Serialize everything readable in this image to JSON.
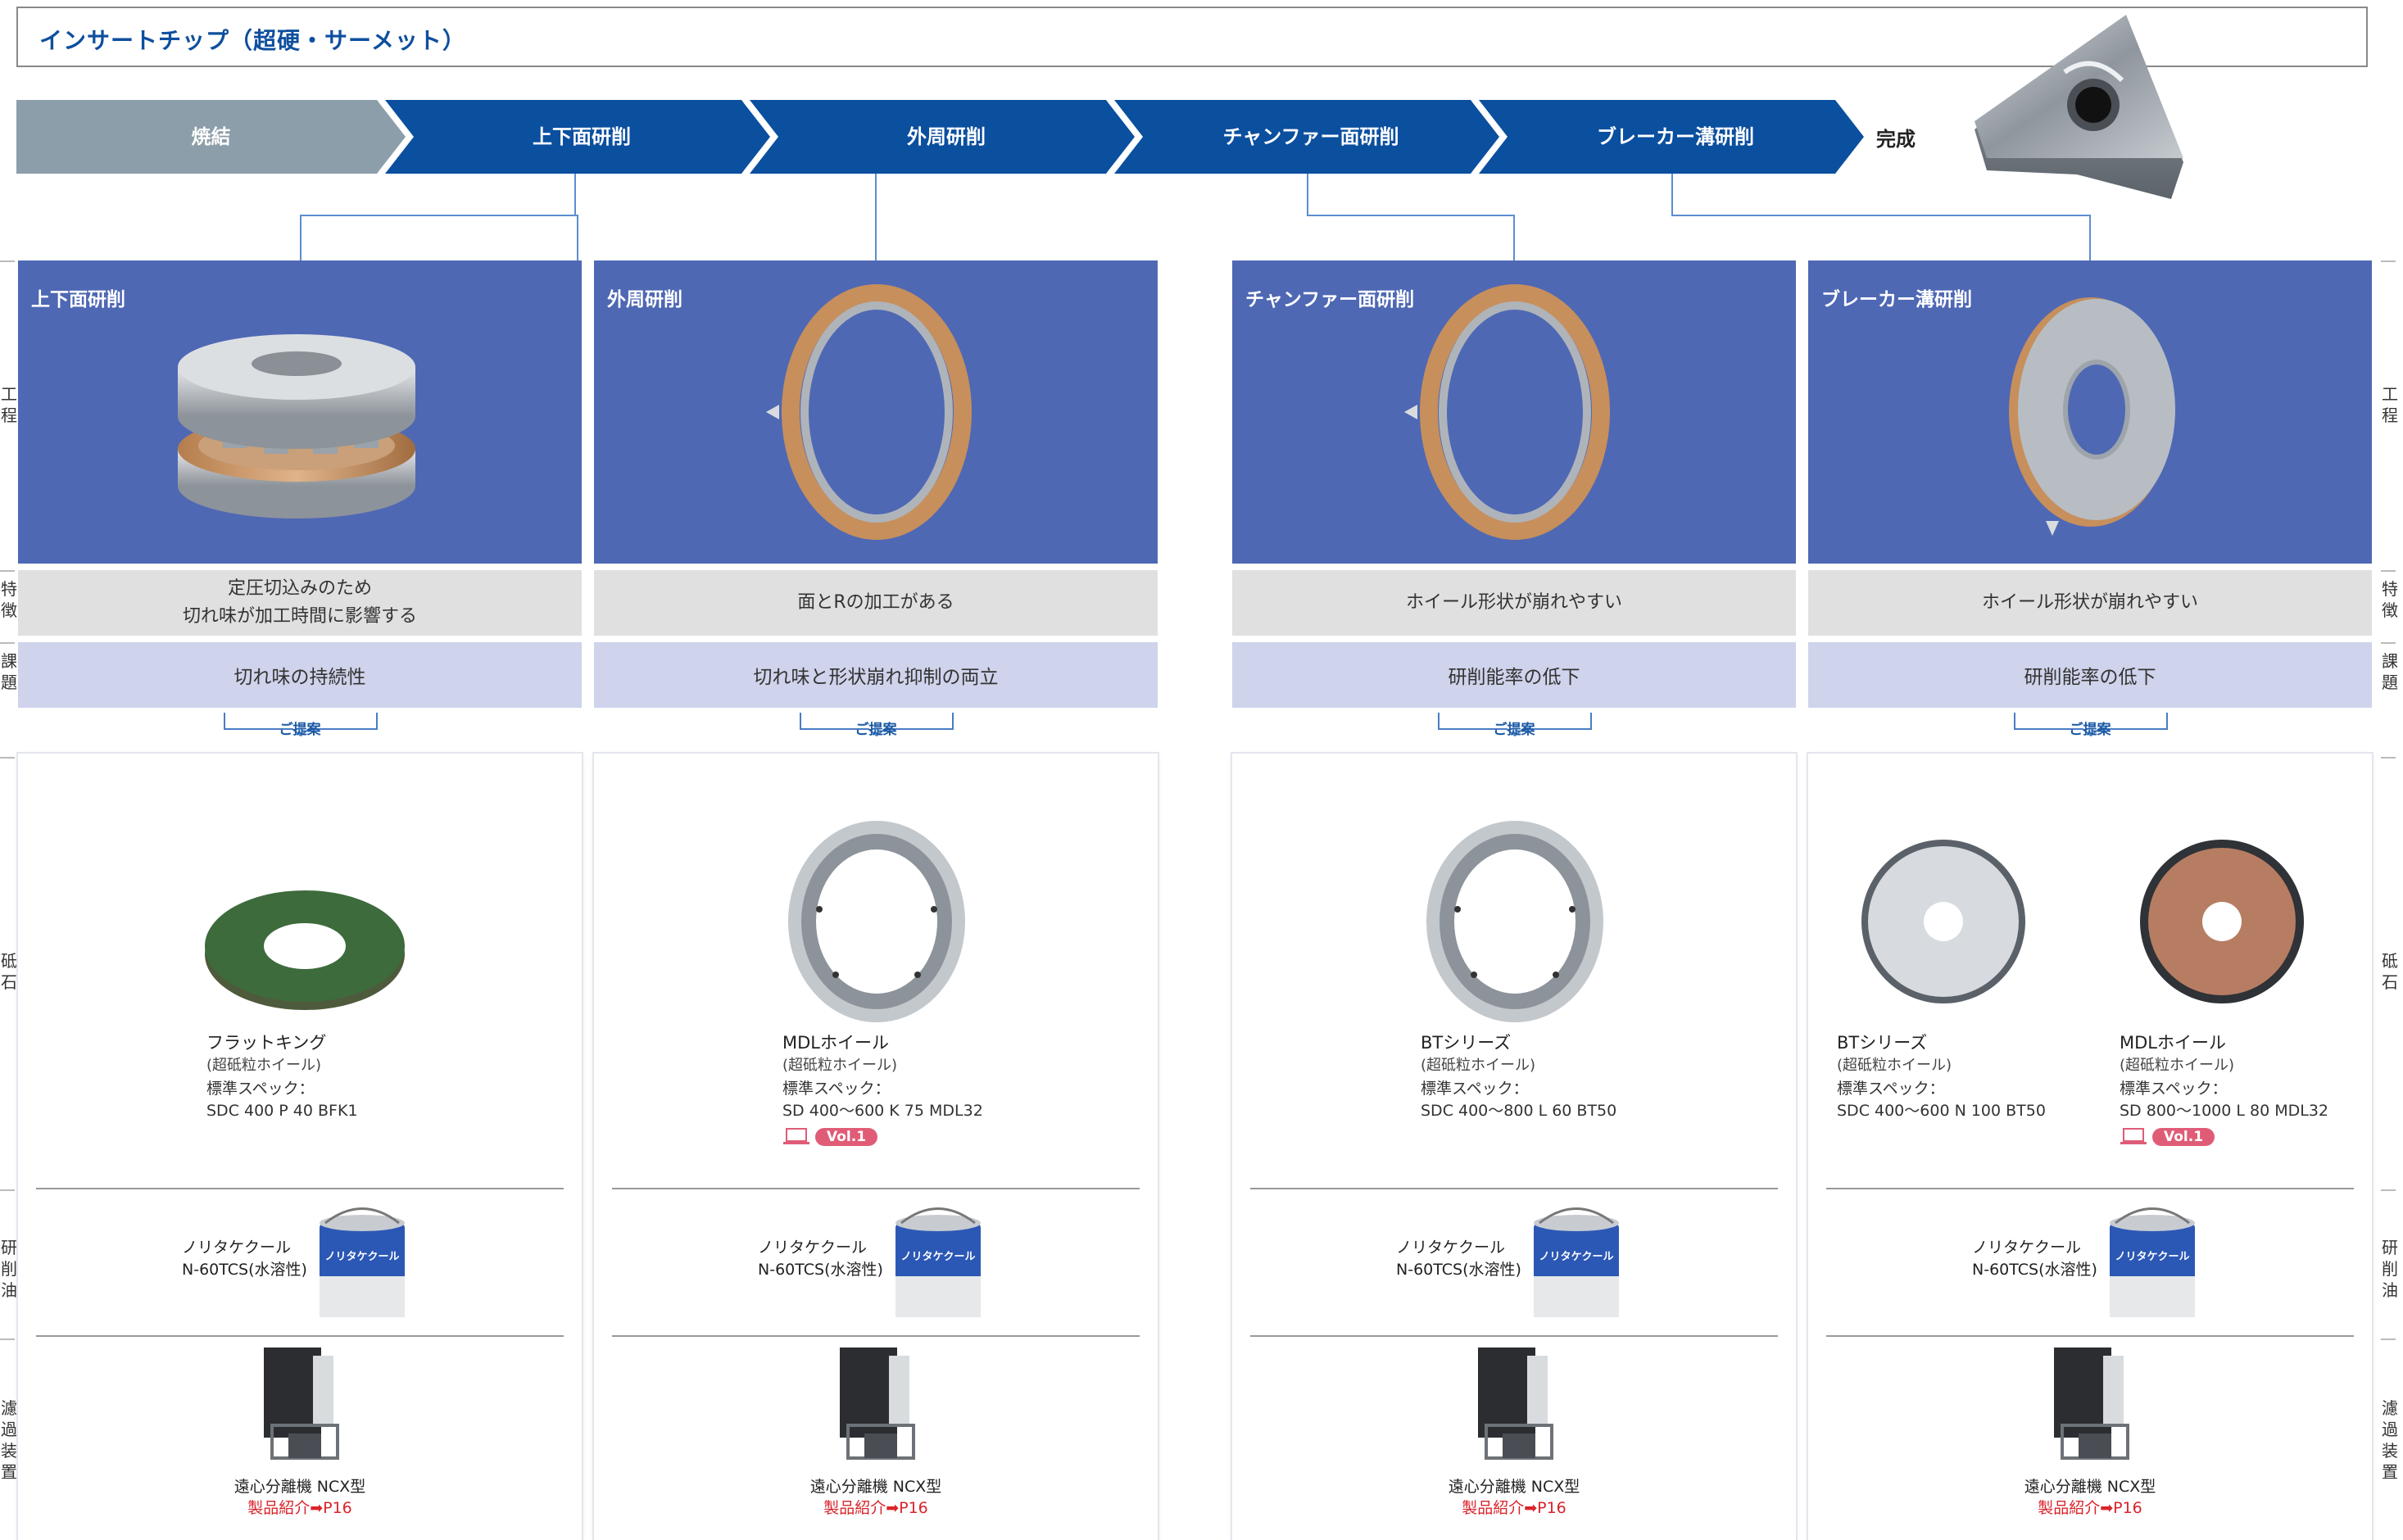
{
  "title": "インサートチップ（超硬・サーメット）",
  "flow": {
    "steps": [
      "焼結",
      "上下面研削",
      "外周研削",
      "チャンファー面研削",
      "ブレーカー溝研削"
    ],
    "final": "完成",
    "colors": {
      "first": "#8c9ea9",
      "rest": "#0b4f9f"
    }
  },
  "side_labels": {
    "process": "工程",
    "feature": "特徴",
    "issue": "課題",
    "wheel": "砥石",
    "oil": "研削油",
    "filter": "濾過装置"
  },
  "columns": [
    {
      "process_title": "上下面研削",
      "feature": "定圧切込みのため\n切れ味が加工時間に影響する",
      "issue": "切れ味の持続性",
      "proposal": "ご提案",
      "wheels": [
        {
          "name": "フラットキング",
          "sub": "(超砥粒ホイール)",
          "spec_label": "標準スペック：",
          "spec": "SDC 400 P 40 BFK1",
          "vol": ""
        }
      ],
      "oil": {
        "line1": "ノリタケクール",
        "line2": "N-60TCS(水溶性)"
      },
      "separator": {
        "name": "遠心分離機 NCX型",
        "link_label": "製品紹介",
        "link_page": "P16"
      }
    },
    {
      "process_title": "外周研削",
      "feature": "面とRの加工がある",
      "issue": "切れ味と形状崩れ抑制の両立",
      "proposal": "ご提案",
      "wheels": [
        {
          "name": "MDLホイール",
          "sub": "(超砥粒ホイール)",
          "spec_label": "標準スペック：",
          "spec": "SD 400～600 K 75 MDL32",
          "vol": "Vol.1"
        }
      ],
      "oil": {
        "line1": "ノリタケクール",
        "line2": "N-60TCS(水溶性)"
      },
      "separator": {
        "name": "遠心分離機 NCX型",
        "link_label": "製品紹介",
        "link_page": "P16"
      }
    },
    {
      "process_title": "チャンファー面研削",
      "feature": "ホイール形状が崩れやすい",
      "issue": "研削能率の低下",
      "proposal": "ご提案",
      "wheels": [
        {
          "name": "BTシリーズ",
          "sub": "(超砥粒ホイール)",
          "spec_label": "標準スペック：",
          "spec": "SDC 400～800 L 60 BT50",
          "vol": ""
        }
      ],
      "oil": {
        "line1": "ノリタケクール",
        "line2": "N-60TCS(水溶性)"
      },
      "separator": {
        "name": "遠心分離機 NCX型",
        "link_label": "製品紹介",
        "link_page": "P16"
      }
    },
    {
      "process_title": "ブレーカー溝研削",
      "feature": "ホイール形状が崩れやすい",
      "issue": "研削能率の低下",
      "proposal": "ご提案",
      "wheels": [
        {
          "name": "BTシリーズ",
          "sub": "(超砥粒ホイール)",
          "spec_label": "標準スペック：",
          "spec": "SDC 400～600 N 100 BT50",
          "vol": ""
        },
        {
          "name": "MDLホイール",
          "sub": "(超砥粒ホイール)",
          "spec_label": "標準スペック：",
          "spec": "SD 800～1000 L 80 MDL32",
          "vol": "Vol.1"
        }
      ],
      "oil": {
        "line1": "ノリタケクール",
        "line2": "N-60TCS(水溶性)"
      },
      "separator": {
        "name": "遠心分離機 NCX型",
        "link_label": "製品紹介",
        "link_page": "P16"
      }
    }
  ],
  "can_label": "ノリタケクール",
  "colors": {
    "brand_blue": "#0b4f9f",
    "process_bg": "#4f68b4",
    "feature_bg": "#e0e0e0",
    "issue_bg": "#cfd3eb",
    "link_red": "#d9242b",
    "vol_badge": "#e05c76"
  }
}
